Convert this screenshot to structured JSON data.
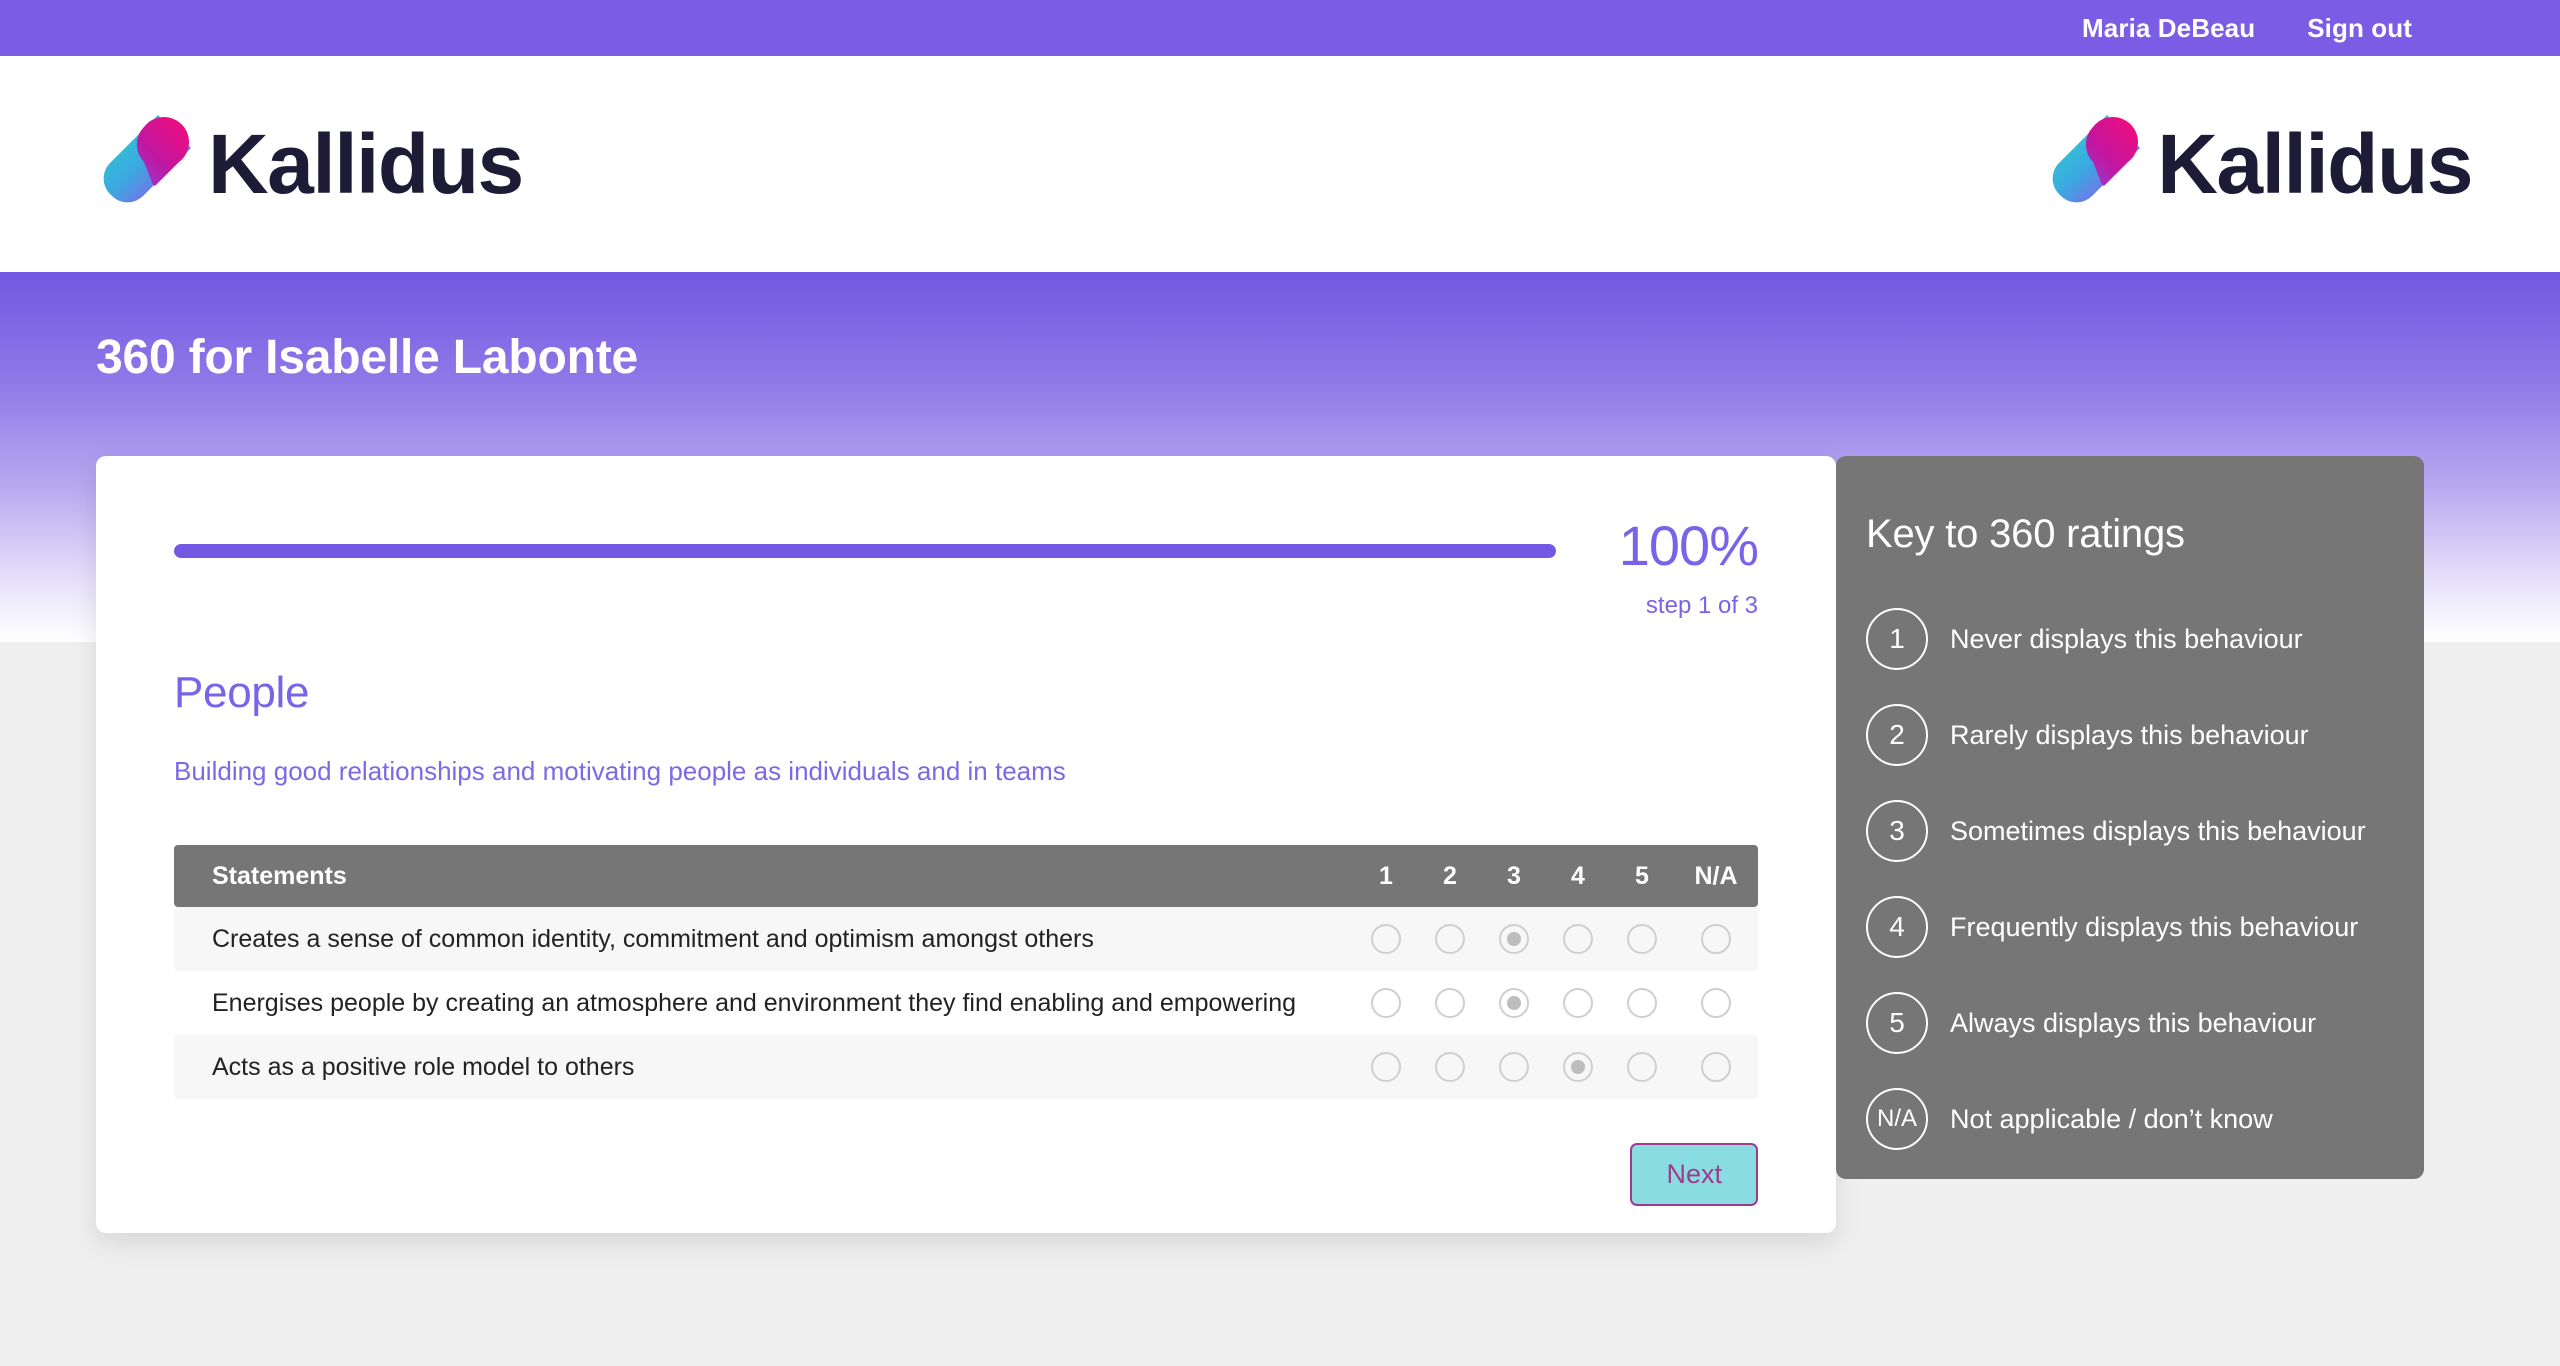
{
  "topbar": {
    "user_name": "Maria DeBeau",
    "sign_out": "Sign out"
  },
  "brand": {
    "name": "Kallidus",
    "colors": {
      "magenta": "#e8128a",
      "teal": "#2ed0ce",
      "purple": "#9b4df0",
      "wordmark": "#1d1b35"
    }
  },
  "hero": {
    "title": "360 for Isabelle Labonte",
    "background_top": "#7257e2"
  },
  "progress": {
    "percent_label": "100%",
    "percent_value": 100,
    "step_label": "step 1 of 3",
    "fill_color": "#7358e4"
  },
  "section": {
    "title": "People",
    "description": "Building good relationships and motivating people as individuals and in teams"
  },
  "table": {
    "statements_header": "Statements",
    "option_headers": [
      "1",
      "2",
      "3",
      "4",
      "5",
      "N/A"
    ],
    "rows": [
      {
        "statement": "Creates a sense of common identity, commitment and optimism amongst others",
        "selected": 3
      },
      {
        "statement": "Energises people by creating an atmosphere and environment they find enabling and empowering",
        "selected": 3
      },
      {
        "statement": "Acts as a positive role model to others",
        "selected": 4
      }
    ]
  },
  "actions": {
    "next_label": "Next",
    "next_bg": "#89dde0",
    "next_border": "#a13a8f"
  },
  "key_panel": {
    "title": "Key to 360 ratings",
    "background": "#767676",
    "items": [
      {
        "value": "1",
        "label": "Never displays this behaviour"
      },
      {
        "value": "2",
        "label": "Rarely displays this behaviour"
      },
      {
        "value": "3",
        "label": "Sometimes displays this behaviour"
      },
      {
        "value": "4",
        "label": "Frequently displays this behaviour"
      },
      {
        "value": "5",
        "label": "Always displays this behaviour"
      },
      {
        "value": "N/A",
        "label": "Not applicable / don’t know"
      }
    ]
  }
}
